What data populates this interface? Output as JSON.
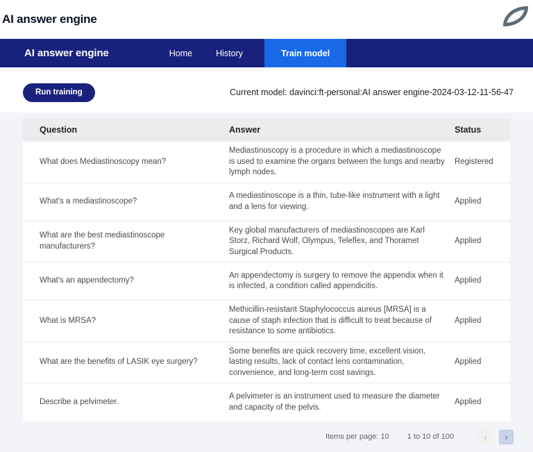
{
  "window": {
    "title": "AI answer engine",
    "logo_icon": "leaf-logo-icon"
  },
  "navbar": {
    "brand": "AI answer engine",
    "items": [
      {
        "label": "Home",
        "active": false
      },
      {
        "label": "History",
        "active": false
      },
      {
        "label": "Train model",
        "active": true
      }
    ]
  },
  "toolbar": {
    "run_button_label": "Run training",
    "current_model": "Current model: davinci:ft-personal:AI answer engine-2024-03-12-11-56-47"
  },
  "table": {
    "columns": [
      "Question",
      "Answer",
      "Status"
    ],
    "rows": [
      {
        "question": "What does Mediastinoscopy mean?",
        "answer": "Mediastinoscopy is a procedure in which a mediastinoscope is used to examine the organs between the lungs and nearby lymph nodes.",
        "status": "Registered"
      },
      {
        "question": "What's a mediastinoscope?",
        "answer": "A mediastinoscope is a thin, tube-like instrument with a light and a lens for viewing.",
        "status": "Applied"
      },
      {
        "question": "What are the best mediastinoscope manufacturers?",
        "answer": "Key global manufacturers of mediastinoscopes are Karl Storz, Richard Wolf, Olympus, Teleflex, and Thoramet Surgical Products.",
        "status": "Applied"
      },
      {
        "question": "What's an appendectomy?",
        "answer": "An appendectomy is surgery to remove the appendix when it is infected, a condition called appendicitis.",
        "status": "Applied"
      },
      {
        "question": "What is MRSA?",
        "answer": "Methicillin-resistant Staphylococcus aureus [MRSA] is a cause of staph infection that is difficult to treat because of resistance to some antibiotics.",
        "status": "Applied"
      },
      {
        "question": "What are the benefits of LASIK eye surgery?",
        "answer": "Some benefits are quick recovery time, excellent vision, lasting results, lack of contact lens contamination, convenience, and long-term cost savings.",
        "status": "Applied"
      },
      {
        "question": "Describe a pelvimeter.",
        "answer": "A pelvimeter is an instrument used to measure the diameter and capacity of the pelvis.",
        "status": "Applied"
      }
    ]
  },
  "paginator": {
    "items_per_page_label": "Items per page: 10",
    "range_label": "1 to 10 of 100",
    "prev_icon": "chevron-left-icon",
    "next_icon": "chevron-right-icon",
    "prev_glyph": "‹",
    "next_glyph": "›"
  },
  "colors": {
    "navbar_bg": "#18217c",
    "active_tab_bg": "#1769e8",
    "run_button_bg": "#18217c",
    "page_bg": "#f3f4f8",
    "table_header_bg": "#ececee",
    "logo_color": "#5d6e7a"
  }
}
